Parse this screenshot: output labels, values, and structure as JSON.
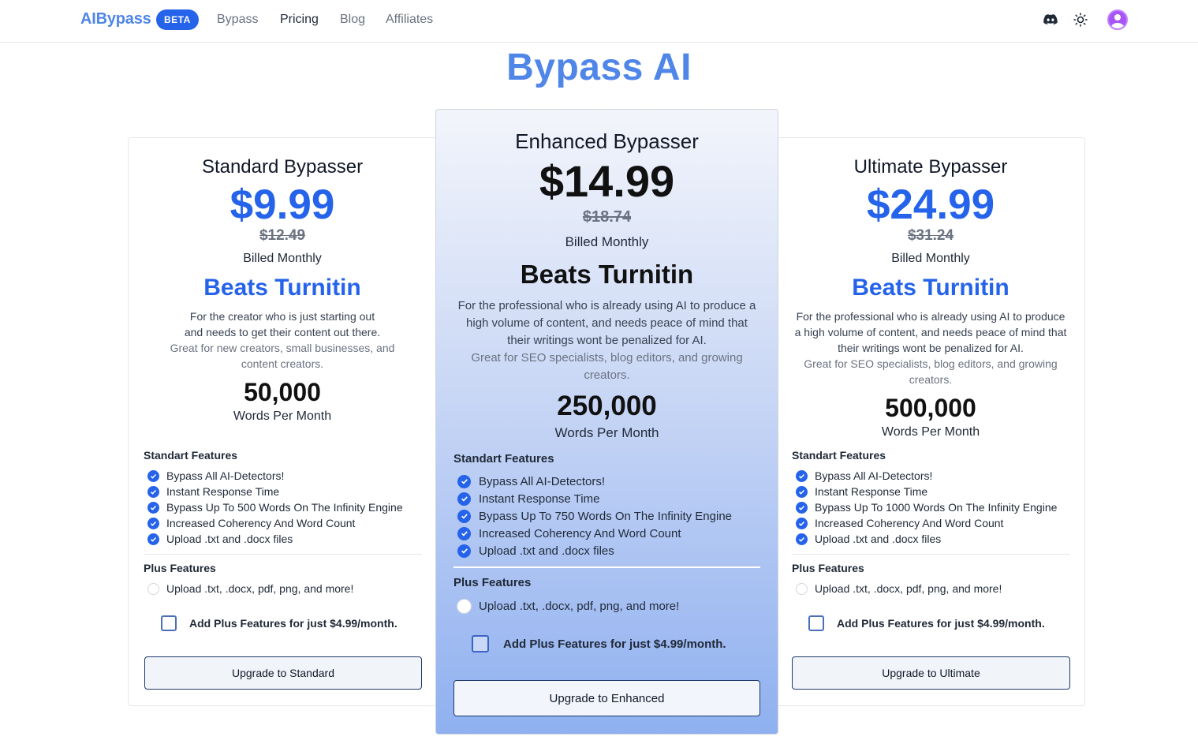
{
  "nav": {
    "brand": "AIBypass",
    "badge": "BETA",
    "links": [
      "Bypass",
      "Pricing",
      "Blog",
      "Affiliates"
    ],
    "active_link": "Pricing",
    "icons": [
      "discord-icon",
      "sun-icon",
      "user-avatar-icon"
    ]
  },
  "page": {
    "title": "Bypass AI"
  },
  "plans": [
    {
      "name": "Standard Bypasser",
      "price": "$9.99",
      "old_price": "$12.49",
      "billing": "Billed Monthly",
      "headline": "Beats Turnitin",
      "desc_1": "For the creator who is just starting out",
      "desc_2": "and needs to get their content out there.",
      "desc_muted": "Great for new creators, small businesses, and content creators.",
      "words": "50,000",
      "words_label": "Words Per Month",
      "standard_heading": "Standart Features",
      "features": [
        "Bypass All AI-Detectors!",
        "Instant Response Time",
        "Bypass Up To 500 Words On The Infinity Engine",
        "Increased Coherency And Word Count",
        "Upload .txt and .docx files"
      ],
      "plus_heading": "Plus Features",
      "plus_features": [
        "Upload .txt, .docx, pdf, png, and more!"
      ],
      "addon_label": "Add Plus Features for just $4.99/month.",
      "addon_checked": false,
      "button": "Upgrade to Standard"
    },
    {
      "name": "Enhanced Bypasser",
      "price": "$14.99",
      "old_price": "$18.74",
      "billing": "Billed Monthly",
      "headline": "Beats Turnitin",
      "desc_1": "For the professional who is already using AI to produce a high volume of content, and needs peace of mind that their writings wont be penalized for AI.",
      "desc_muted": "Great for SEO specialists, blog editors, and growing creators.",
      "words": "250,000",
      "words_label": "Words Per Month",
      "standard_heading": "Standart Features",
      "features": [
        "Bypass All AI-Detectors!",
        "Instant Response Time",
        "Bypass Up To 750 Words On The Infinity Engine",
        "Increased Coherency And Word Count",
        "Upload .txt and .docx files"
      ],
      "plus_heading": "Plus Features",
      "plus_features": [
        "Upload .txt, .docx, pdf, png, and more!"
      ],
      "addon_label": "Add Plus Features for just $4.99/month.",
      "addon_checked": false,
      "button": "Upgrade to Enhanced"
    },
    {
      "name": "Ultimate Bypasser",
      "price": "$24.99",
      "old_price": "$31.24",
      "billing": "Billed Monthly",
      "headline": "Beats Turnitin",
      "desc_1": "For the professional who is already using AI to produce a high volume of content, and needs peace of mind that their writings wont be penalized for AI.",
      "desc_muted": "Great for SEO specialists, blog editors, and growing creators.",
      "words": "500,000",
      "words_label": "Words Per Month",
      "standard_heading": "Standart Features",
      "features": [
        "Bypass All AI-Detectors!",
        "Instant Response Time",
        "Bypass Up To 1000 Words On The Infinity Engine",
        "Increased Coherency And Word Count",
        "Upload .txt and .docx files"
      ],
      "plus_heading": "Plus Features",
      "plus_features": [
        "Upload .txt, .docx, pdf, png, and more!"
      ],
      "addon_label": "Add Plus Features for just $4.99/month.",
      "addon_checked": false,
      "button": "Upgrade to Ultimate"
    }
  ],
  "colors": {
    "brand": "#4f86e8",
    "accent": "#2563eb",
    "avatar": "#a855f7"
  }
}
